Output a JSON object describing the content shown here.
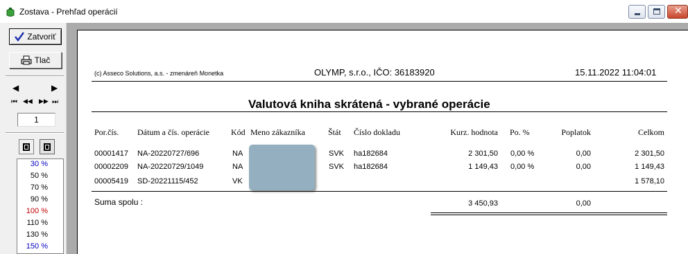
{
  "window": {
    "title": "Zostava - Prehľad operácií",
    "controls": {
      "close_glyph": "✕"
    }
  },
  "toolbar": {
    "close_label": "Zatvoriť",
    "print_label": "Tlač",
    "nav": {
      "prev": "◀",
      "next": "▶",
      "first": "⏮",
      "back": "◀◀",
      "fwd": "▶▶",
      "last": "⏭"
    },
    "page_value": "1"
  },
  "zoom": {
    "options": [
      {
        "label": "30 %",
        "color": "#0000c0"
      },
      {
        "label": "50 %",
        "color": "#000000"
      },
      {
        "label": "70 %",
        "color": "#000000"
      },
      {
        "label": "90 %",
        "color": "#000000"
      },
      {
        "label": "100 %",
        "color": "#c00000"
      },
      {
        "label": "110 %",
        "color": "#000000"
      },
      {
        "label": "130 %",
        "color": "#000000"
      },
      {
        "label": "150 %",
        "color": "#0000c0"
      }
    ]
  },
  "report": {
    "company_note": "(c) Asseco Solutions, a.s. - zmenáreň Monetka",
    "company_id": "OLYMP, s.r.o., IČO: 36183920",
    "datetime": "15.11.2022 11:04:01",
    "title": "Valutová kniha skrátená - vybrané operácie",
    "columns": {
      "por": "Por.čís.",
      "datum": "Dátum a čís. operácie",
      "kod": "Kód",
      "meno": "Meno zákazníka",
      "stat": "Štát",
      "doklad": "Číslo dokladu",
      "kurz": "Kurz. hodnota",
      "po": "Po. %",
      "poplatok": "Poplatok",
      "celkom": "Celkom"
    },
    "rows": [
      {
        "por": "00001417",
        "datum": "NA-20220727/696",
        "kod": "NA",
        "stat": "SVK",
        "doklad": "ha182684",
        "kurz": "2 301,50",
        "po": "0,00 %",
        "poplatok": "0,00",
        "celkom": "2 301,50"
      },
      {
        "por": "00002209",
        "datum": "NA-20220729/1049",
        "kod": "NA",
        "stat": "SVK",
        "doklad": "ha182684",
        "kurz": "1 149,43",
        "po": "0,00 %",
        "poplatok": "0,00",
        "celkom": "1 149,43"
      },
      {
        "por": "00005419",
        "datum": "SD-20221115/452",
        "kod": "VK",
        "stat": "",
        "doklad": "",
        "kurz": "",
        "po": "",
        "poplatok": "",
        "celkom": "1 578,10"
      }
    ],
    "sum_label": "Suma spolu :",
    "sum_kurz": "3 450,93",
    "sum_poplatok": "0,00"
  }
}
